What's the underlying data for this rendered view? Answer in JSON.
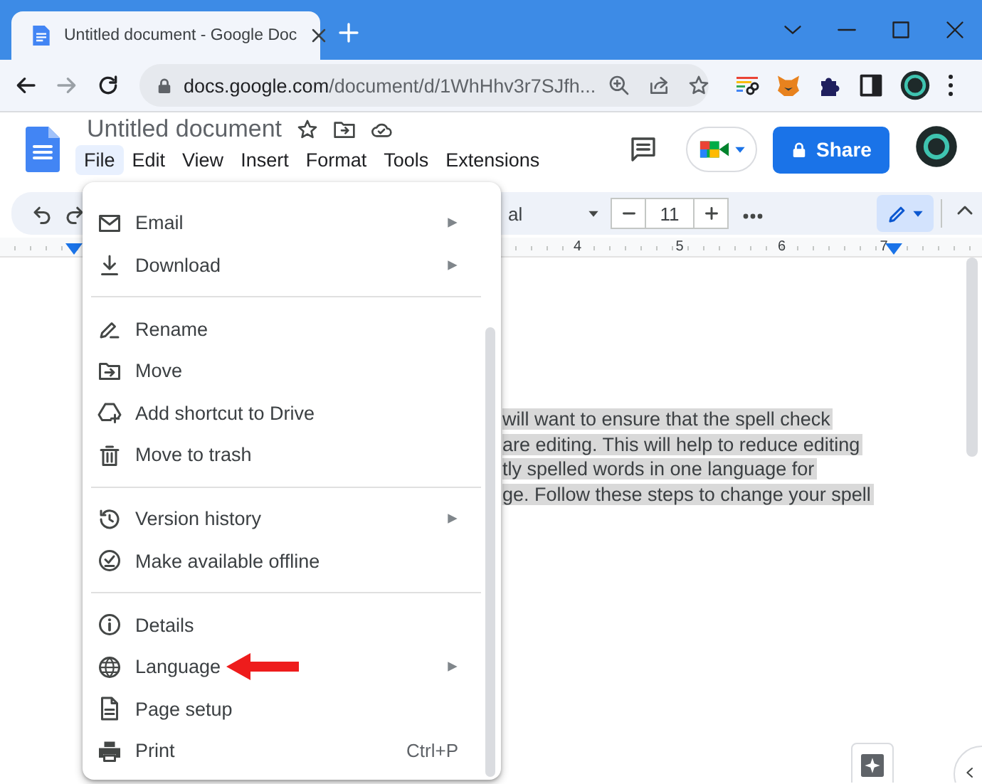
{
  "browser": {
    "tab_title": "Untitled document - Google Doc",
    "url_host": "docs.google.com",
    "url_path": "/document/d/1WhHhv3r7SJfh..."
  },
  "docs": {
    "title": "Untitled document",
    "share": "Share",
    "menus": [
      {
        "label": "File",
        "selected": true
      },
      {
        "label": "Edit",
        "selected": false
      },
      {
        "label": "View",
        "selected": false
      },
      {
        "label": "Insert",
        "selected": false
      },
      {
        "label": "Format",
        "selected": false
      },
      {
        "label": "Tools",
        "selected": false
      },
      {
        "label": "Extensions",
        "selected": false
      }
    ]
  },
  "toolbar": {
    "font": "al",
    "font_size": "11"
  },
  "ruler": {
    "numbers": [
      "4",
      "5",
      "6",
      "7"
    ]
  },
  "document": {
    "lines": [
      {
        "text": "will want to ensure that the spell check",
        "highlighted": true
      },
      {
        "text": "are editing. This will help to reduce editing",
        "highlighted": true
      },
      {
        "text": "tly spelled words in one language for",
        "highlighted": true
      },
      {
        "text": "ge. Follow these steps to change your spell",
        "highlighted": true
      }
    ]
  },
  "file_menu": {
    "items": [
      {
        "kind": "item",
        "label": "Email",
        "submenu": true
      },
      {
        "kind": "item",
        "label": "Download",
        "submenu": true
      },
      {
        "kind": "divider"
      },
      {
        "kind": "item",
        "label": "Rename",
        "submenu": false
      },
      {
        "kind": "item",
        "label": "Move",
        "submenu": false
      },
      {
        "kind": "item",
        "label": "Add shortcut to Drive",
        "submenu": false
      },
      {
        "kind": "item",
        "label": "Move to trash",
        "submenu": false
      },
      {
        "kind": "divider"
      },
      {
        "kind": "item",
        "label": "Version history",
        "submenu": true
      },
      {
        "kind": "item",
        "label": "Make available offline",
        "submenu": false
      },
      {
        "kind": "divider"
      },
      {
        "kind": "item",
        "label": "Details",
        "submenu": false
      },
      {
        "kind": "item",
        "label": "Language",
        "submenu": true,
        "pointed_at": true
      },
      {
        "kind": "item",
        "label": "Page setup",
        "submenu": false
      },
      {
        "kind": "item",
        "label": "Print",
        "submenu": false,
        "shortcut": "Ctrl+P"
      }
    ]
  }
}
